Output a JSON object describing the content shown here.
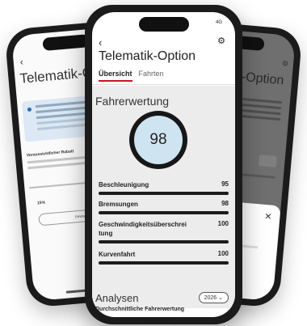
{
  "front": {
    "status": "4G",
    "back_icon": "‹",
    "gear_icon": "⚙",
    "title": "Telematik-Option",
    "tabs": [
      {
        "label": "Übersicht",
        "active": true
      },
      {
        "label": "Fahrten",
        "active": false
      }
    ],
    "section_title": "Fahrerwertung",
    "score": "98",
    "metrics": [
      {
        "label": "Beschleunigung",
        "value": "95",
        "fraction": 0.95
      },
      {
        "label": "Bremsungen",
        "value": "98",
        "fraction": 0.98
      },
      {
        "label": "Geschwindigkeitsüberschreitung",
        "value": "100",
        "fraction": 1.0
      },
      {
        "label": "Kurvenfahrt",
        "value": "100",
        "fraction": 1.0
      }
    ],
    "analysis_title": "Analysen",
    "year": "2026 ⌄",
    "analysis_subtitle": "Durchschnittliche Fahrerwertung"
  },
  "left": {
    "back_icon": "‹",
    "title": "Telematik-O",
    "info_line1": "Sichern Sie sich bei Tele",
    "info_line2": "bis zu 15 % Rabatt auf",
    "expected_label": "Voraussichtlicher Rabatt",
    "percent": "15%",
    "button_label": "Erhöhen Sie Ihr..."
  },
  "right": {
    "title": "-Option",
    "close_icon": "✕"
  },
  "colors": {
    "accent": "#d01024",
    "score_fill": "#cfe4f1",
    "section_bg": "#ececec"
  }
}
